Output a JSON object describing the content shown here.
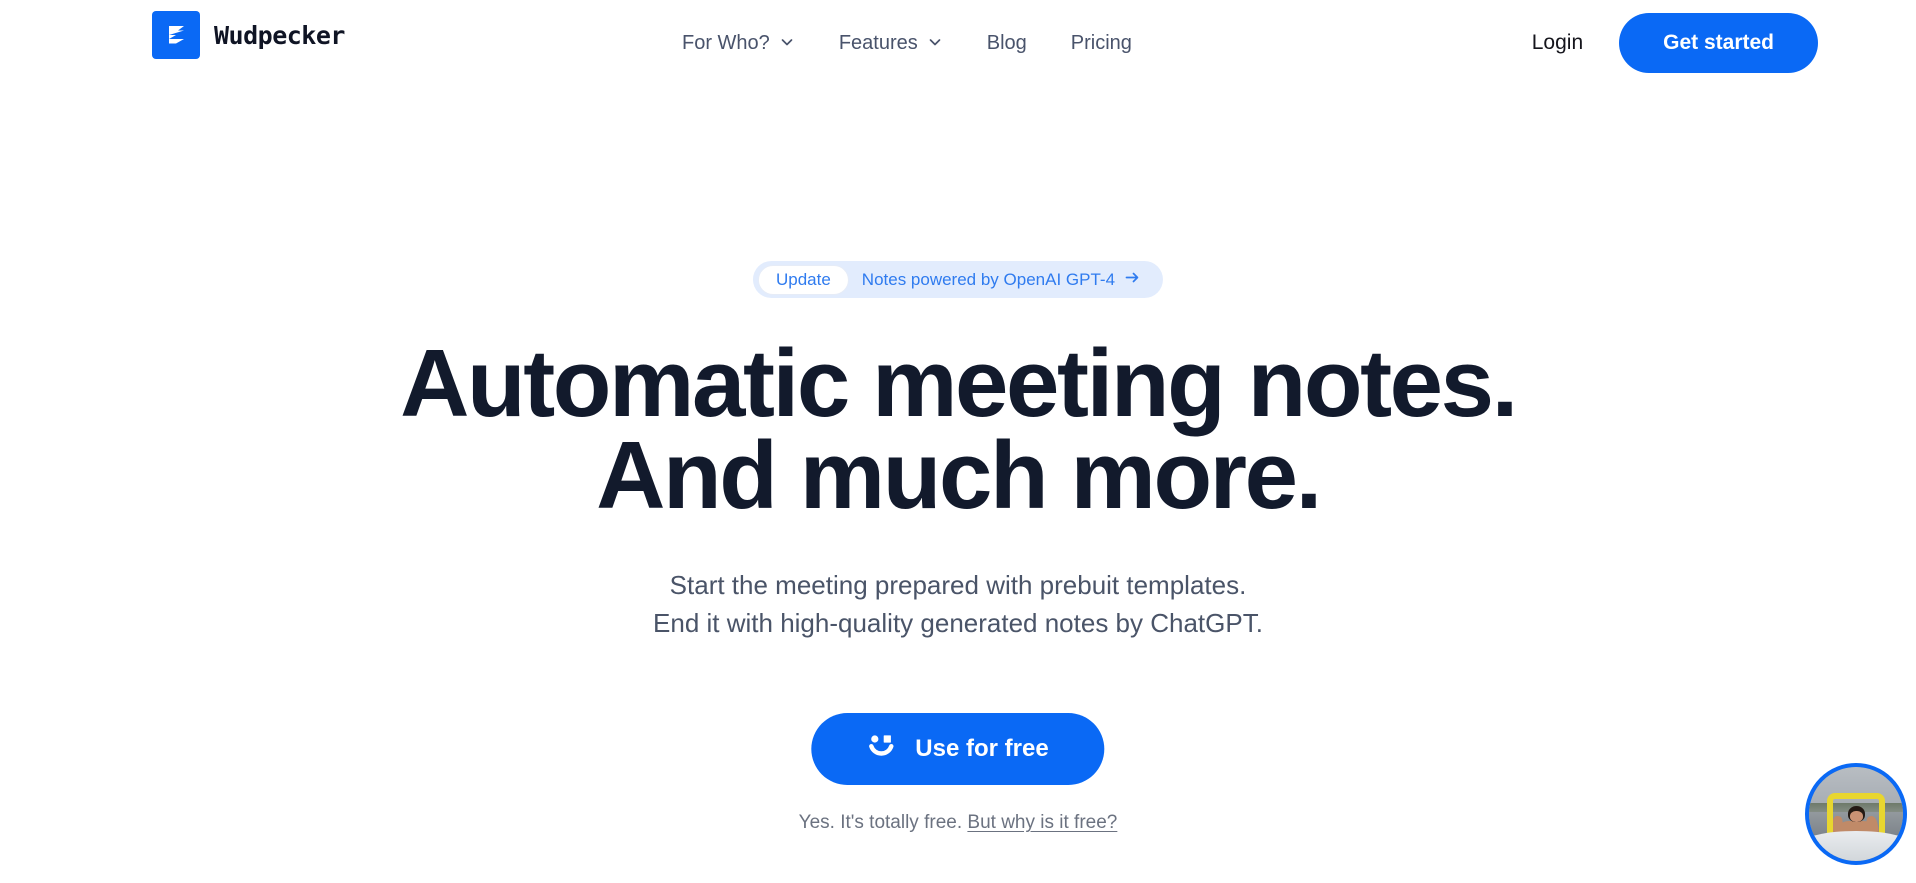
{
  "brand": {
    "name": "Wudpecker",
    "mark_icon": "wudpecker-logo-icon",
    "mark_color": "#0a69f5"
  },
  "header": {
    "nav": [
      {
        "label": "For Who?",
        "has_dropdown": true,
        "icon": "chevron-down-icon"
      },
      {
        "label": "Features",
        "has_dropdown": true,
        "icon": "chevron-down-icon"
      },
      {
        "label": "Blog",
        "has_dropdown": false
      },
      {
        "label": "Pricing",
        "has_dropdown": false
      }
    ],
    "login_label": "Login",
    "get_started_label": "Get started",
    "accent_color": "#0a69f5"
  },
  "hero": {
    "badge": {
      "chip_label": "Update",
      "text": "Notes powered by OpenAI GPT-4",
      "arrow_icon": "arrow-right-icon",
      "background": "#e2ecfd",
      "text_color": "#2f7bef"
    },
    "headline_line1": "Automatic meeting notes.",
    "headline_line2": "And much more.",
    "headline_color": "#121a2c",
    "subhead_line1": "Start the meeting prepared with prebuit templates.",
    "subhead_line2": "End it with high-quality generated notes by ChatGPT.",
    "cta": {
      "label": "Use for free",
      "icon": "smiley-face-icon",
      "background": "#0a69f5"
    },
    "free_note_text": "Yes. It's totally free.",
    "free_note_link": "But why is it free?"
  },
  "video_bubble": {
    "name": "video-bubble-widget",
    "ring_color": "#0a69f5",
    "description": "person in icy water holding a yellow frame"
  }
}
